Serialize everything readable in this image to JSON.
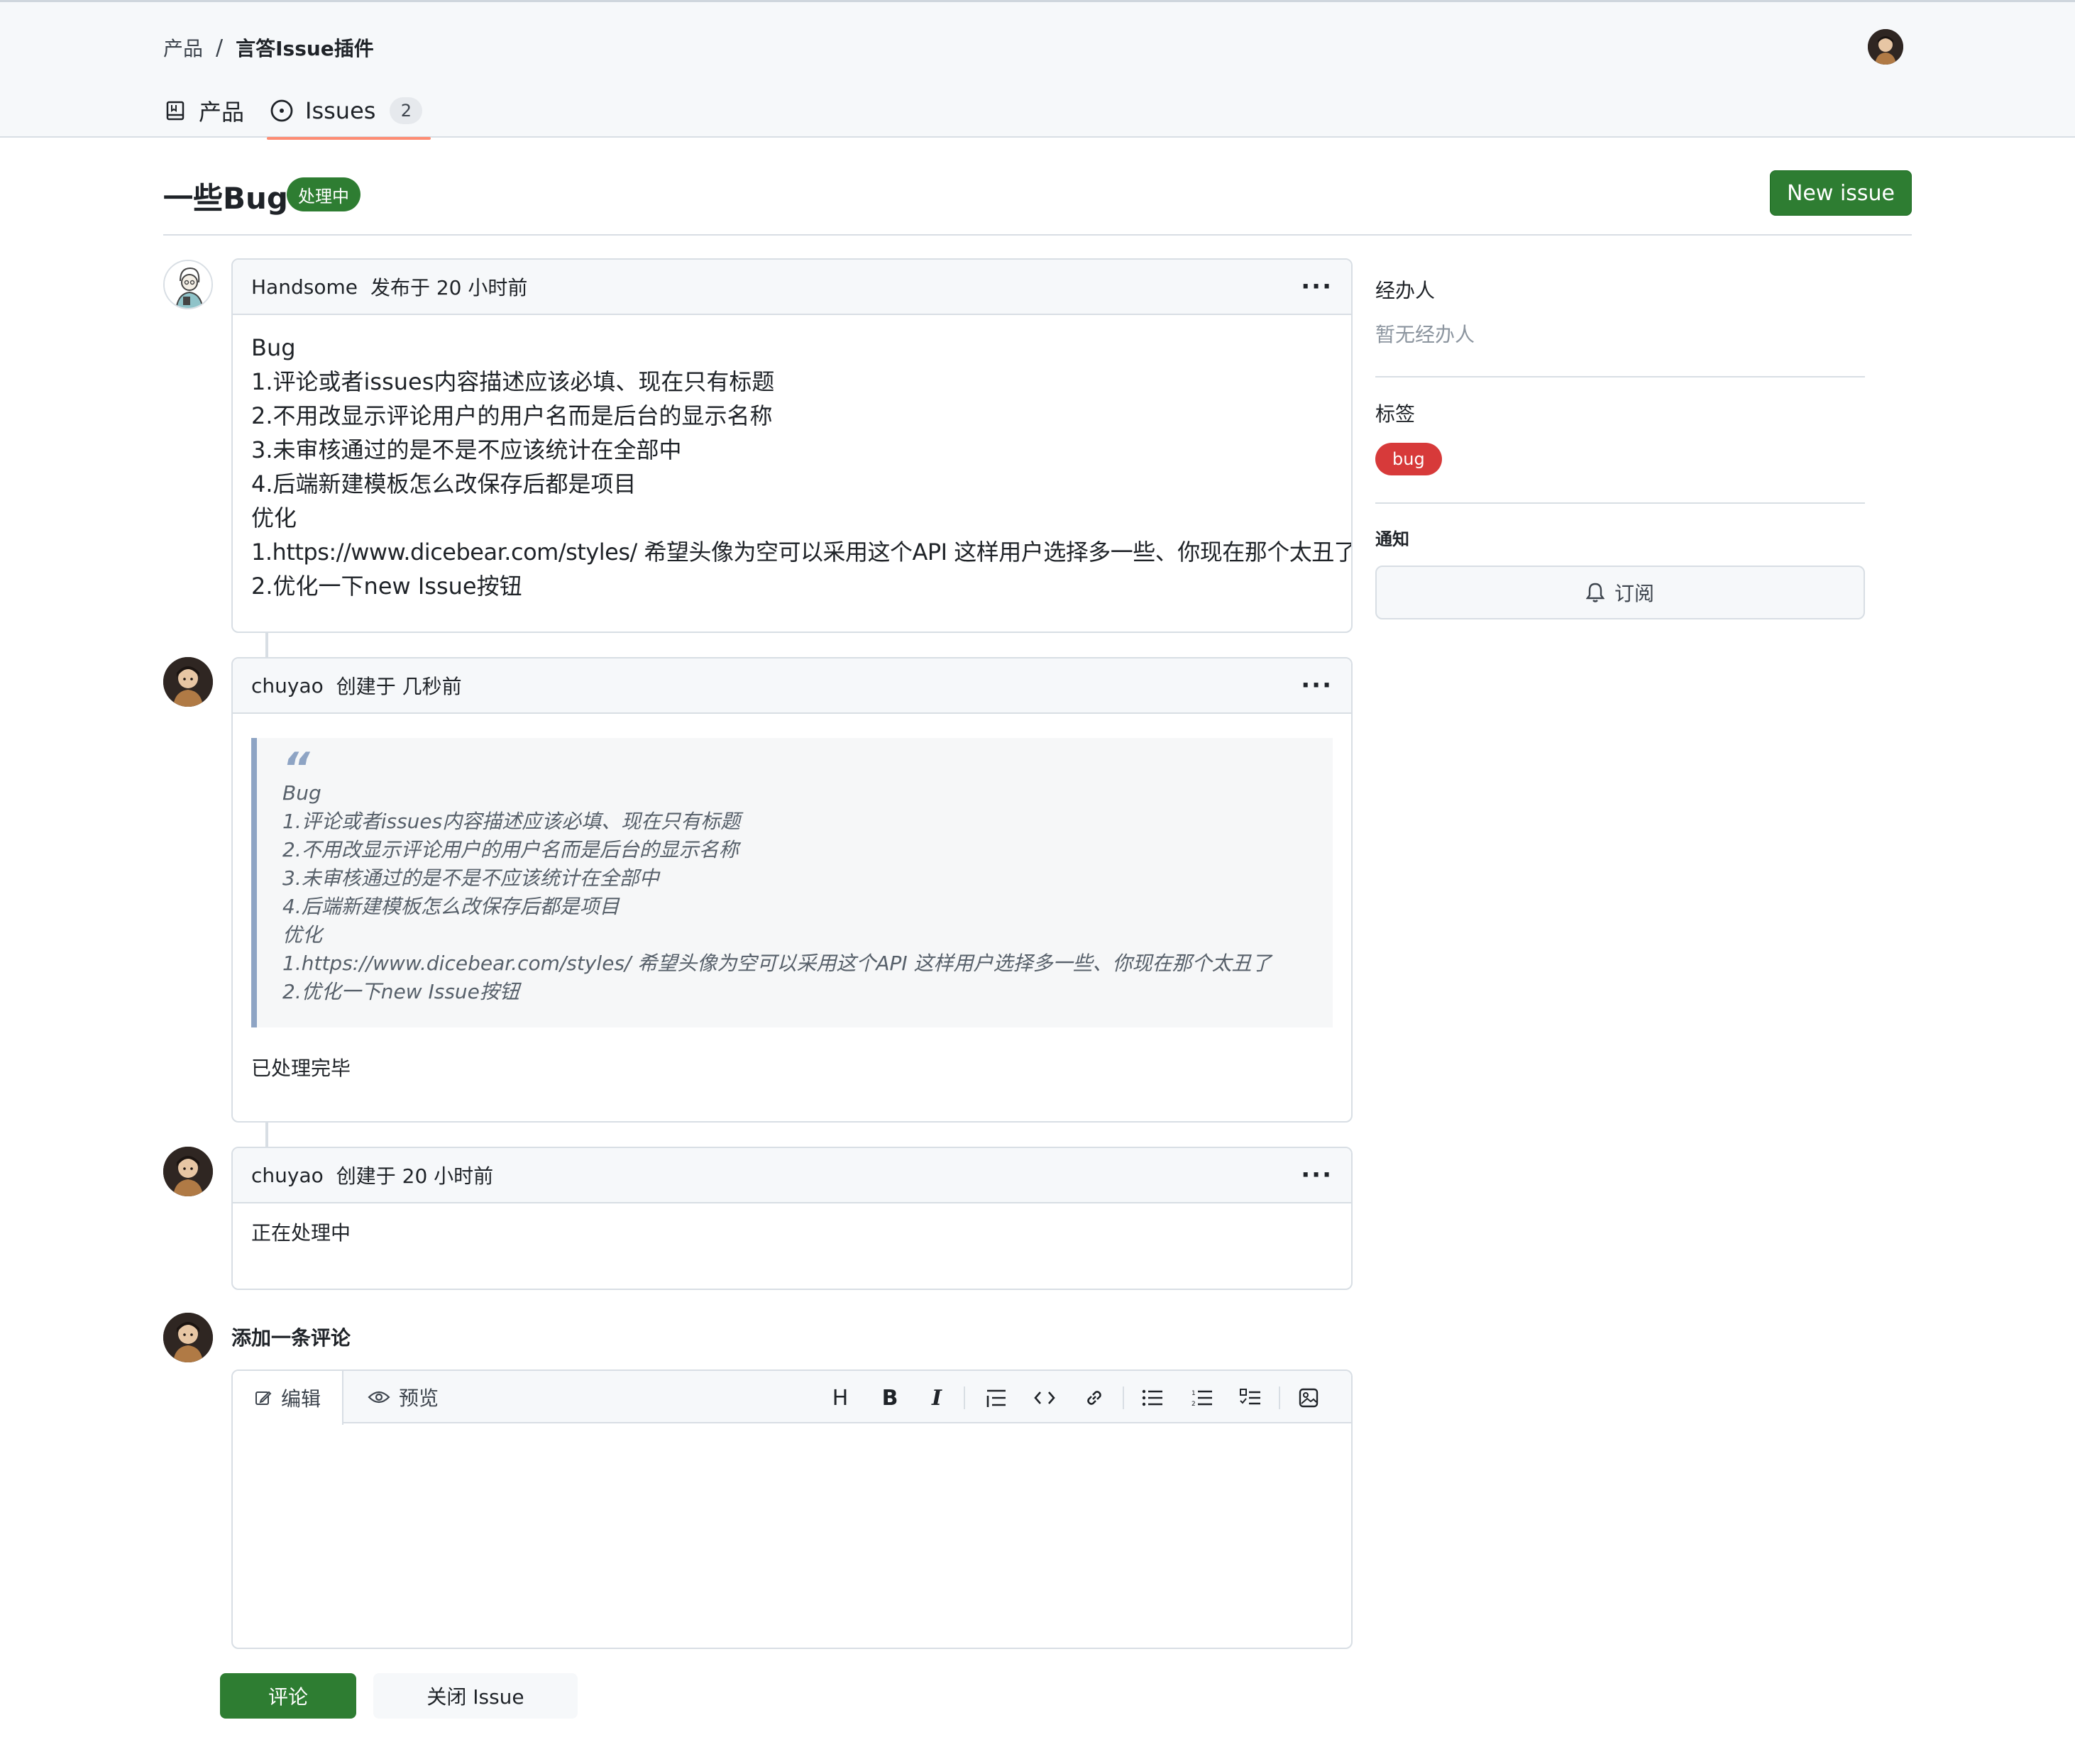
{
  "breadcrumb": {
    "parent": "产品",
    "separator": "/",
    "current": "言答Issue插件"
  },
  "tabs": [
    {
      "label": "产品",
      "icon": "repo-icon"
    },
    {
      "label": "Issues",
      "icon": "issue-opened-icon",
      "count": "2"
    }
  ],
  "issue": {
    "title": "一些Bug",
    "state": "处理中"
  },
  "new_issue_label": "New issue",
  "comments": [
    {
      "author": "Handsome",
      "meta": "发布于 20 小时前",
      "body_lines": [
        "Bug",
        "1.评论或者issues内容描述应该必填、现在只有标题",
        "2.不用改显示评论用户的用户名而是后台的显示名称",
        "3.未审核通过的是不是不应该统计在全部中",
        "4.后端新建模板怎么改保存后都是项目",
        "优化",
        "1.https://www.dicebear.com/styles/ 希望头像为空可以采用这个API 这样用户选择多一些、你现在那个太丑了",
        "2.优化一下new Issue按钮"
      ]
    },
    {
      "author": "chuyao",
      "meta": "创建于 几秒前",
      "quote_mark": "“",
      "quote_lines": [
        "Bug",
        "1.评论或者issues内容描述应该必填、现在只有标题",
        "2.不用改显示评论用户的用户名而是后台的显示名称",
        "3.未审核通过的是不是不应该统计在全部中",
        "4.后端新建模板怎么改保存后都是项目",
        "优化",
        "1.https://www.dicebear.com/styles/ 希望头像为空可以采用这个API 这样用户选择多一些、你现在那个太丑了",
        "2.优化一下new Issue按钮"
      ],
      "body": "已处理完毕"
    },
    {
      "author": "chuyao",
      "meta": "创建于 20 小时前",
      "body": "正在处理中"
    }
  ],
  "more_label": "···",
  "composer": {
    "title": "添加一条评论",
    "tab_edit": "编辑",
    "tab_preview": "预览",
    "tools": {
      "heading": "H",
      "bold": "B",
      "italic": "I"
    },
    "submit_label": "评论",
    "close_label": "关闭 Issue"
  },
  "sidebar": {
    "assignee_heading": "经办人",
    "assignee_empty": "暂无经办人",
    "labels_heading": "标签",
    "labels": [
      {
        "name": "bug",
        "color": "#d73a3a"
      }
    ],
    "notify_heading": "通知",
    "subscribe_label": "订阅"
  },
  "colors": {
    "primary_green": "#2e7d32",
    "tab_underline": "#fd8c73",
    "quote_border": "#8ea4c4"
  }
}
